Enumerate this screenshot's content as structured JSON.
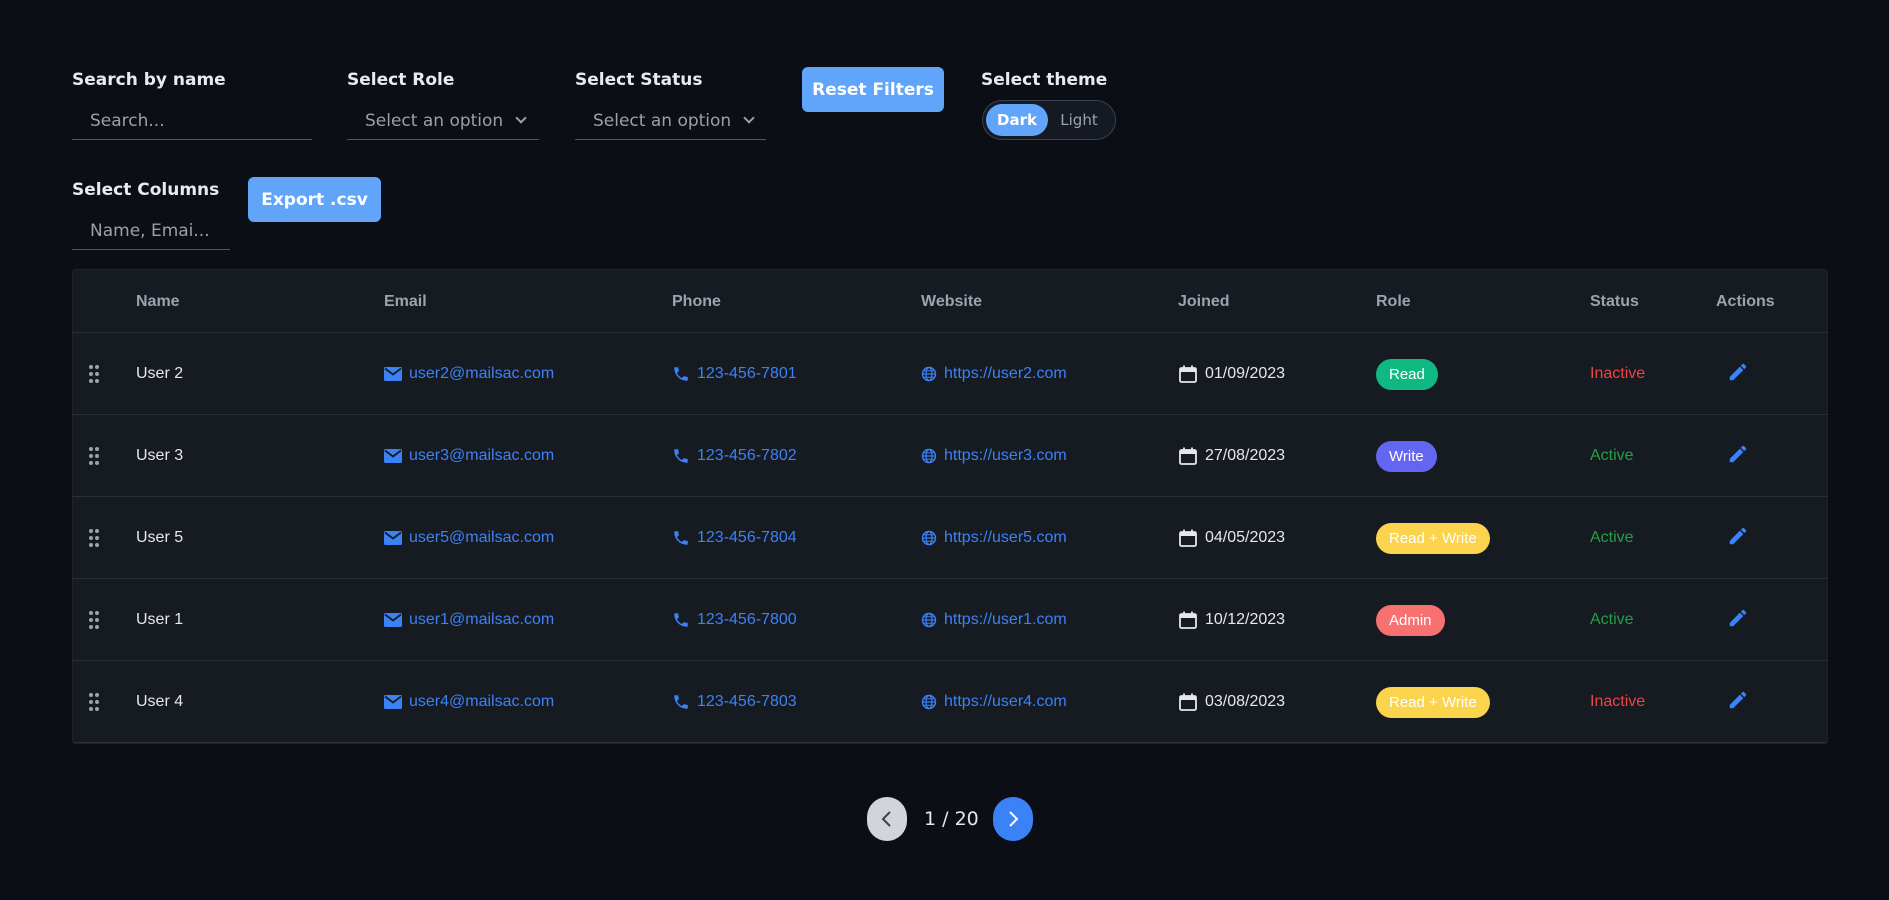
{
  "filters": {
    "search": {
      "label": "Search by name",
      "placeholder": "Search..."
    },
    "role": {
      "label": "Select Role",
      "value": "Select an option"
    },
    "status": {
      "label": "Select Status",
      "value": "Select an option"
    },
    "reset_label": "Reset Filters",
    "theme": {
      "label": "Select theme",
      "options": [
        "Dark",
        "Light"
      ],
      "selected": "Dark"
    },
    "columns": {
      "label": "Select Columns",
      "value": "Name, Emai..."
    },
    "export_label": "Export .csv"
  },
  "table": {
    "columns": [
      "Name",
      "Email",
      "Phone",
      "Website",
      "Joined",
      "Role",
      "Status",
      "Actions"
    ],
    "rows": [
      {
        "name": "User 2",
        "email": "user2@mailsac.com",
        "phone": "123-456-7801",
        "website": "https://user2.com",
        "joined": "01/09/2023",
        "role": "Read",
        "status": "Inactive"
      },
      {
        "name": "User 3",
        "email": "user3@mailsac.com",
        "phone": "123-456-7802",
        "website": "https://user3.com",
        "joined": "27/08/2023",
        "role": "Write",
        "status": "Active"
      },
      {
        "name": "User 5",
        "email": "user5@mailsac.com",
        "phone": "123-456-7804",
        "website": "https://user5.com",
        "joined": "04/05/2023",
        "role": "Read + Write",
        "status": "Active"
      },
      {
        "name": "User 1",
        "email": "user1@mailsac.com",
        "phone": "123-456-7800",
        "website": "https://user1.com",
        "joined": "10/12/2023",
        "role": "Admin",
        "status": "Active"
      },
      {
        "name": "User 4",
        "email": "user4@mailsac.com",
        "phone": "123-456-7803",
        "website": "https://user4.com",
        "joined": "03/08/2023",
        "role": "Read + Write",
        "status": "Inactive"
      }
    ]
  },
  "role_colors": {
    "Read": "#10b981",
    "Write": "#6366f1",
    "Read + Write": "#fcd34d",
    "Admin": "#f87171"
  },
  "status_colors": {
    "Active": "#22a046",
    "Inactive": "#ef4444"
  },
  "icons": {
    "email": "mail-icon",
    "phone": "phone-icon",
    "website": "globe-icon",
    "joined": "calendar-icon",
    "action": "edit-icon",
    "drag": "drag-handle-icon",
    "prev": "chevron-left-icon",
    "next": "chevron-right-icon"
  },
  "pagination": {
    "current": 1,
    "total": 20,
    "text": "1 / 20"
  }
}
